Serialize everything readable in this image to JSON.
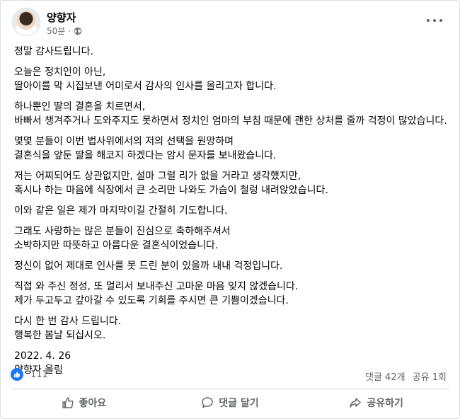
{
  "post": {
    "author": "양향자",
    "time": "50분",
    "separator": "·",
    "paragraphs": [
      "정말 감사드립니다.",
      "오늘은 정치인이 아닌,\n딸아이를 막 시집보낸 어미로서 감사의 인사를 올리고자 합니다.",
      "하나뿐인 딸의 결혼을 치르면서,\n바빠서 챙겨주거나 도와주지도 못하면서 정치인 엄마의 부침 때문에 괜한 상처를 줄까 걱정이 많았습니다.",
      "몇몇 분들이 이번 법사위에서의 저의 선택을 원망하며\n결혼식을 앞둔 딸을 해코지 하겠다는 암시 문자를 보내왔습니다.",
      "저는 어찌되어도 상관없지만, 설마 그럴 리가 없을 거라고 생각했지만,\n혹시나 하는 마음에 식장에서 큰 소리만 나와도 가슴이 철렁 내려앉았습니다.",
      "이와 같은 일은 제가 마지막이길 간절히 기도합니다.",
      "그래도 사랑하는 많은 분들이 진심으로 축하해주셔서\n소박하지만 따뜻하고 아름다운 결혼식이었습니다.",
      "정신이 없어 제대로 인사를 못 드린 분이 있을까 내내 걱정입니다.",
      "직접 와 주신 정성, 또 멀리서 보내주신 고마운 마음 잊지 않겠습니다.\n제가 두고두고 갚아갈 수 있도록 기회를 주시면 큰 기쁨이겠습니다.",
      "다시 한 번 감사 드립니다.\n행복한 봄날 되십시오.",
      "2022. 4. 26\n양향자 올림"
    ]
  },
  "stats": {
    "likes": "111",
    "comments": "댓글 42개",
    "shares": "공유 1회"
  },
  "actions": {
    "like": "좋아요",
    "comment": "댓글 달기",
    "share": "공유하기"
  },
  "icons": {
    "privacy": "globe-icon",
    "more": "more-options-icon",
    "like": "thumbs-up-icon",
    "comment": "comment-icon",
    "share": "share-icon"
  },
  "colors": {
    "brand": "#1877f2",
    "secondary_text": "#65676b"
  }
}
